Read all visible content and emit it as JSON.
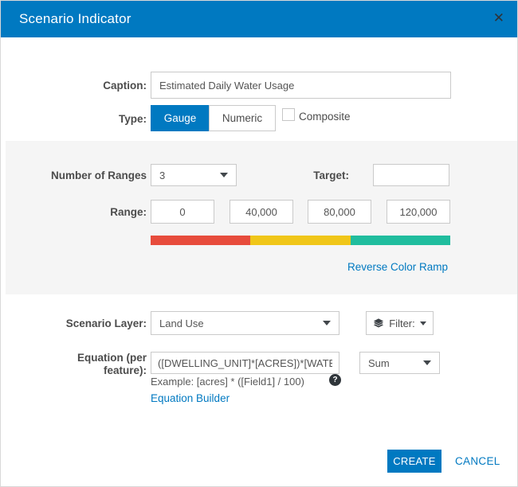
{
  "colors": {
    "accent": "#0079c1",
    "panel_bg": "#f5f5f5",
    "link": "#0079c1",
    "ramp": [
      "#e74c3c",
      "#f0c619",
      "#20bd9e"
    ]
  },
  "dialog": {
    "title": "Scenario Indicator",
    "close_glyph": "✕"
  },
  "caption": {
    "label": "Caption:",
    "value": "Estimated Daily Water Usage"
  },
  "type": {
    "label": "Type:",
    "options": [
      {
        "label": "Gauge",
        "selected": true
      },
      {
        "label": "Numeric",
        "selected": false
      }
    ],
    "composite": {
      "label": "Composite",
      "checked": false
    }
  },
  "ranges": {
    "number_of_ranges_label": "Number of Ranges",
    "number_of_ranges_value": "3",
    "target_label": "Target:",
    "target_value": "",
    "range_label": "Range:",
    "values": [
      "0",
      "40,000",
      "80,000",
      "120,000"
    ],
    "reverse_link_label": "Reverse Color Ramp"
  },
  "layer": {
    "label": "Scenario Layer:",
    "value": "Land Use",
    "filter_label": "Filter:"
  },
  "equation": {
    "label_line1": "Equation (per",
    "label_line2": "feature):",
    "value": "([DWELLING_UNIT]*[ACRES])*[WATE",
    "aggregation": "Sum",
    "example": "Example: [acres] * ([Field1] / 100)",
    "help_glyph": "?",
    "builder_link_label": "Equation Builder"
  },
  "footer": {
    "create_label": "CREATE",
    "cancel_label": "CANCEL"
  }
}
